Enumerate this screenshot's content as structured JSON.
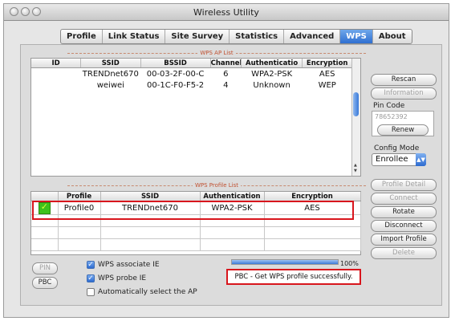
{
  "window": {
    "title": "Wireless Utility"
  },
  "tabs": [
    {
      "label": "Profile"
    },
    {
      "label": "Link Status"
    },
    {
      "label": "Site Survey"
    },
    {
      "label": "Statistics"
    },
    {
      "label": "Advanced"
    },
    {
      "label": "WPS"
    },
    {
      "label": "About"
    }
  ],
  "ap_list": {
    "title": "WPS AP List",
    "columns": [
      "ID",
      "SSID",
      "BSSID",
      "Channel",
      "Authenticatio",
      "Encryption"
    ],
    "rows": [
      {
        "id": "",
        "ssid": "TRENDnet670",
        "bssid": "00-03-2F-00-C",
        "channel": "6",
        "auth": "WPA2-PSK",
        "enc": "AES"
      },
      {
        "id": "",
        "ssid": "weiwei",
        "bssid": "00-1C-F0-F5-2",
        "channel": "4",
        "auth": "Unknown",
        "enc": "WEP"
      }
    ]
  },
  "right_panel": {
    "rescan": "Rescan",
    "information": "Information",
    "pin_code_label": "Pin Code",
    "pin_code_value": "78652392",
    "renew": "Renew",
    "config_mode_label": "Config Mode",
    "config_mode_value": "Enrollee",
    "profile_detail": "Profile Detail",
    "connect": "Connect",
    "rotate": "Rotate",
    "disconnect": "Disconnect",
    "import_profile": "Import Profile",
    "delete": "Delete"
  },
  "profile_list": {
    "title": "WPS Profile List",
    "columns": [
      "",
      "Profile",
      "SSID",
      "Authentication",
      "Encryption"
    ],
    "rows": [
      {
        "status": "connected",
        "profile": "Profile0",
        "ssid": "TRENDnet670",
        "auth": "WPA2-PSK",
        "enc": "AES"
      }
    ]
  },
  "bottom": {
    "pin_button": "PIN",
    "pbc_button": "PBC",
    "wps_associate_ie": "WPS associate IE",
    "wps_probe_ie": "WPS probe IE",
    "auto_select": "Automatically select the AP",
    "checkboxes": [
      true,
      true,
      false
    ],
    "progress": 1.0,
    "progress_text": "100%",
    "status_message": "PBC - Get WPS profile successfully."
  },
  "colors": {
    "accent_blue": "#2f6fd1",
    "highlight_red": "#d8161d",
    "connected_green": "#3ec21c"
  }
}
